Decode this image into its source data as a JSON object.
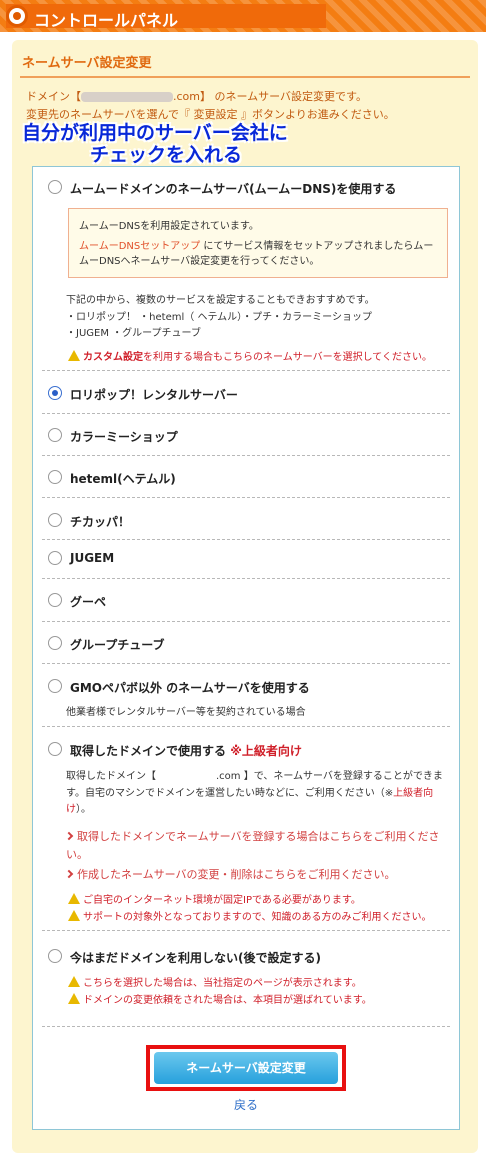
{
  "header": {
    "title": "コントロールパネル"
  },
  "panel": {
    "title": "ネームサーバ設定変更",
    "intro_prefix": "ドメイン【",
    "intro_domain_suffix": ".com】",
    "intro_rest": "のネームサーバ設定変更です。",
    "intro_line2": "変更先のネームサーバを選んで『 変更設定 』ボタンよりお進みください。"
  },
  "annotation": {
    "line1": "自分が利用中のサーバー会社に",
    "line2": "チェックを入れる"
  },
  "options": {
    "muumuu": {
      "label": "ムームードメインのネームサーバ(ムームーDNS)を使用する"
    },
    "lolipop": {
      "label": "ロリポップ！レンタルサーバー"
    },
    "colorme": {
      "label": "カラーミーショップ"
    },
    "heteml": {
      "label": "heteml(ヘテムル)"
    },
    "chicappa": {
      "label": "チカッパ！"
    },
    "jugem": {
      "label": "JUGEM"
    },
    "goope": {
      "label": "グーペ"
    },
    "grouptube": {
      "label": "グループチューブ"
    },
    "gmo_other": {
      "label": "GMOペパボ以外 のネームサーバを使用する",
      "desc": "他業者様でレンタルサーバー等を契約されている場合"
    },
    "own": {
      "label": "取得したドメインで使用する",
      "tag": "※上級者向け"
    },
    "later": {
      "label": "今はまだドメインを利用しない(後で設定する)"
    }
  },
  "muumuu_note": {
    "line1": "ムームーDNSを利用設定されています。",
    "link": "ムームーDNSセットアップ",
    "line2a": "にてサービス情報をセットアップされましたらムー",
    "line2b": "ムーDNSへネームサーバ設定変更を行ってください。"
  },
  "muumuu_info": {
    "line1": "下記の中から、複数のサービスを設定することもできおすすめです。",
    "line2": "・ロリポップ！ ・heteml（ ヘテムル）・プチ・カラーミーショップ",
    "line3": "・JUGEM ・グループチューブ",
    "warn_em": "カスタム設定",
    "warn_rest": "を利用する場合もこちらのネームサーバーを選択してください。"
  },
  "own_info": {
    "line1a": "取得したドメイン【",
    "line1b": ".com 】で、ネームサーバを登録することができま",
    "line2a": "す。自宅のマシンでドメインを運営したい時などに、ご利用ください（※",
    "line2_em": "上級者向",
    "line3_em": "け",
    "line3b": "）。",
    "link1a": "取得したドメインでネームサーバを登録する場合はこちらをご利用くださ",
    "link1b": "い。",
    "link2": "作成したネームサーバの変更・削除はこちらをご利用ください。",
    "warn1": "ご自宅のインターネット環境が固定IPである必要があります。",
    "warn2": "サポートの対象外となっておりますので、知識のある方のみご利用ください。"
  },
  "later_info": {
    "warn1": "こちらを選択した場合は、当社指定のページが表示されます。",
    "warn2": "ドメインの変更依頼をされた場合は、本項目が選ばれています。"
  },
  "actions": {
    "submit": "ネームサーバ設定変更",
    "back": "戻る"
  },
  "colors": {
    "accent": "#f47d12",
    "panel_bg": "#fdf5cf",
    "button": "#26a0dc",
    "highlight": "#e81010",
    "annotation": "#0828d8"
  }
}
